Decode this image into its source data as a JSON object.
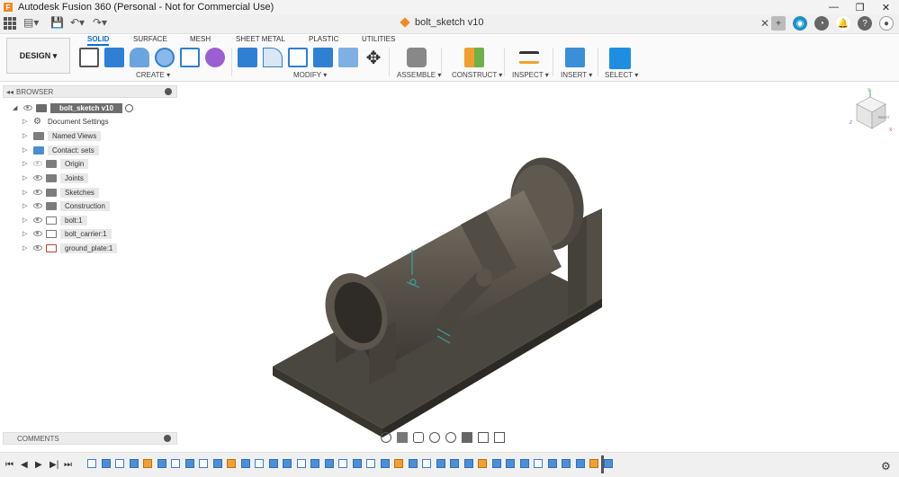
{
  "window": {
    "title": "Autodesk Fusion 360 (Personal - Not for Commercial Use)",
    "minimize": "—",
    "maximize": "❐",
    "close": "✕"
  },
  "doc_tab": {
    "name": "bolt_sketch v10",
    "close": "✕"
  },
  "ribbon": {
    "workspace": "DESIGN ▾",
    "tabs": [
      "SOLID",
      "SURFACE",
      "MESH",
      "SHEET METAL",
      "PLASTIC",
      "UTILITIES"
    ],
    "groups": [
      "CREATE ▾",
      "MODIFY ▾",
      "ASSEMBLE ▾",
      "CONSTRUCT ▾",
      "INSPECT ▾",
      "INSERT ▾",
      "SELECT ▾"
    ]
  },
  "browser": {
    "header": "BROWSER",
    "root": "bolt_sketch v10",
    "items": [
      {
        "label": "Document Settings",
        "icon": "gear-icon"
      },
      {
        "label": "Named Views",
        "icon": "folder-icon"
      },
      {
        "label": "Contact: sets",
        "icon": "contact-sets-icon"
      },
      {
        "label": "Origin",
        "icon": "folder-icon"
      },
      {
        "label": "Joints",
        "icon": "folder-icon"
      },
      {
        "label": "Sketches",
        "icon": "folder-icon"
      },
      {
        "label": "Construction",
        "icon": "folder-icon"
      },
      {
        "label": "bolt:1",
        "icon": "component-icon"
      },
      {
        "label": "bolt_carrier:1",
        "icon": "component-icon"
      },
      {
        "label": "ground_plate:1",
        "icon": "component-icon"
      }
    ]
  },
  "comments": {
    "label": "COMMENTS"
  },
  "viewcube": {
    "face_label": "RIGHT",
    "axis_x": "X",
    "axis_y": "Y",
    "axis_z": "Z"
  },
  "colors": {
    "accent": "#0a6ed1",
    "model": "#5b554c",
    "brand_orange": "#f08a24"
  }
}
